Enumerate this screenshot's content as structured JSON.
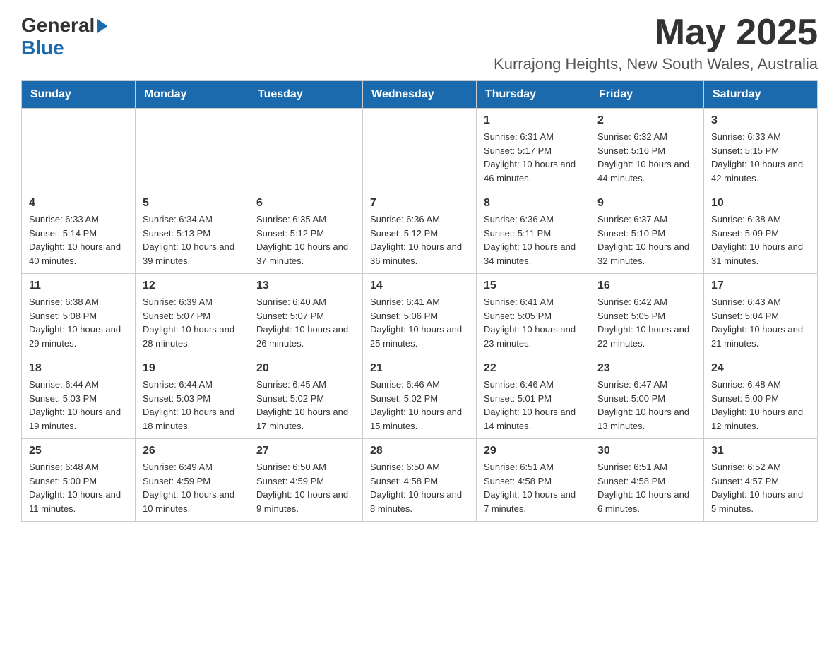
{
  "header": {
    "logo_general": "General",
    "logo_blue": "Blue",
    "month_title": "May 2025",
    "location": "Kurrajong Heights, New South Wales, Australia"
  },
  "days_of_week": [
    "Sunday",
    "Monday",
    "Tuesday",
    "Wednesday",
    "Thursday",
    "Friday",
    "Saturday"
  ],
  "weeks": [
    [
      {
        "day": "",
        "info": ""
      },
      {
        "day": "",
        "info": ""
      },
      {
        "day": "",
        "info": ""
      },
      {
        "day": "",
        "info": ""
      },
      {
        "day": "1",
        "info": "Sunrise: 6:31 AM\nSunset: 5:17 PM\nDaylight: 10 hours and 46 minutes."
      },
      {
        "day": "2",
        "info": "Sunrise: 6:32 AM\nSunset: 5:16 PM\nDaylight: 10 hours and 44 minutes."
      },
      {
        "day": "3",
        "info": "Sunrise: 6:33 AM\nSunset: 5:15 PM\nDaylight: 10 hours and 42 minutes."
      }
    ],
    [
      {
        "day": "4",
        "info": "Sunrise: 6:33 AM\nSunset: 5:14 PM\nDaylight: 10 hours and 40 minutes."
      },
      {
        "day": "5",
        "info": "Sunrise: 6:34 AM\nSunset: 5:13 PM\nDaylight: 10 hours and 39 minutes."
      },
      {
        "day": "6",
        "info": "Sunrise: 6:35 AM\nSunset: 5:12 PM\nDaylight: 10 hours and 37 minutes."
      },
      {
        "day": "7",
        "info": "Sunrise: 6:36 AM\nSunset: 5:12 PM\nDaylight: 10 hours and 36 minutes."
      },
      {
        "day": "8",
        "info": "Sunrise: 6:36 AM\nSunset: 5:11 PM\nDaylight: 10 hours and 34 minutes."
      },
      {
        "day": "9",
        "info": "Sunrise: 6:37 AM\nSunset: 5:10 PM\nDaylight: 10 hours and 32 minutes."
      },
      {
        "day": "10",
        "info": "Sunrise: 6:38 AM\nSunset: 5:09 PM\nDaylight: 10 hours and 31 minutes."
      }
    ],
    [
      {
        "day": "11",
        "info": "Sunrise: 6:38 AM\nSunset: 5:08 PM\nDaylight: 10 hours and 29 minutes."
      },
      {
        "day": "12",
        "info": "Sunrise: 6:39 AM\nSunset: 5:07 PM\nDaylight: 10 hours and 28 minutes."
      },
      {
        "day": "13",
        "info": "Sunrise: 6:40 AM\nSunset: 5:07 PM\nDaylight: 10 hours and 26 minutes."
      },
      {
        "day": "14",
        "info": "Sunrise: 6:41 AM\nSunset: 5:06 PM\nDaylight: 10 hours and 25 minutes."
      },
      {
        "day": "15",
        "info": "Sunrise: 6:41 AM\nSunset: 5:05 PM\nDaylight: 10 hours and 23 minutes."
      },
      {
        "day": "16",
        "info": "Sunrise: 6:42 AM\nSunset: 5:05 PM\nDaylight: 10 hours and 22 minutes."
      },
      {
        "day": "17",
        "info": "Sunrise: 6:43 AM\nSunset: 5:04 PM\nDaylight: 10 hours and 21 minutes."
      }
    ],
    [
      {
        "day": "18",
        "info": "Sunrise: 6:44 AM\nSunset: 5:03 PM\nDaylight: 10 hours and 19 minutes."
      },
      {
        "day": "19",
        "info": "Sunrise: 6:44 AM\nSunset: 5:03 PM\nDaylight: 10 hours and 18 minutes."
      },
      {
        "day": "20",
        "info": "Sunrise: 6:45 AM\nSunset: 5:02 PM\nDaylight: 10 hours and 17 minutes."
      },
      {
        "day": "21",
        "info": "Sunrise: 6:46 AM\nSunset: 5:02 PM\nDaylight: 10 hours and 15 minutes."
      },
      {
        "day": "22",
        "info": "Sunrise: 6:46 AM\nSunset: 5:01 PM\nDaylight: 10 hours and 14 minutes."
      },
      {
        "day": "23",
        "info": "Sunrise: 6:47 AM\nSunset: 5:00 PM\nDaylight: 10 hours and 13 minutes."
      },
      {
        "day": "24",
        "info": "Sunrise: 6:48 AM\nSunset: 5:00 PM\nDaylight: 10 hours and 12 minutes."
      }
    ],
    [
      {
        "day": "25",
        "info": "Sunrise: 6:48 AM\nSunset: 5:00 PM\nDaylight: 10 hours and 11 minutes."
      },
      {
        "day": "26",
        "info": "Sunrise: 6:49 AM\nSunset: 4:59 PM\nDaylight: 10 hours and 10 minutes."
      },
      {
        "day": "27",
        "info": "Sunrise: 6:50 AM\nSunset: 4:59 PM\nDaylight: 10 hours and 9 minutes."
      },
      {
        "day": "28",
        "info": "Sunrise: 6:50 AM\nSunset: 4:58 PM\nDaylight: 10 hours and 8 minutes."
      },
      {
        "day": "29",
        "info": "Sunrise: 6:51 AM\nSunset: 4:58 PM\nDaylight: 10 hours and 7 minutes."
      },
      {
        "day": "30",
        "info": "Sunrise: 6:51 AM\nSunset: 4:58 PM\nDaylight: 10 hours and 6 minutes."
      },
      {
        "day": "31",
        "info": "Sunrise: 6:52 AM\nSunset: 4:57 PM\nDaylight: 10 hours and 5 minutes."
      }
    ]
  ]
}
